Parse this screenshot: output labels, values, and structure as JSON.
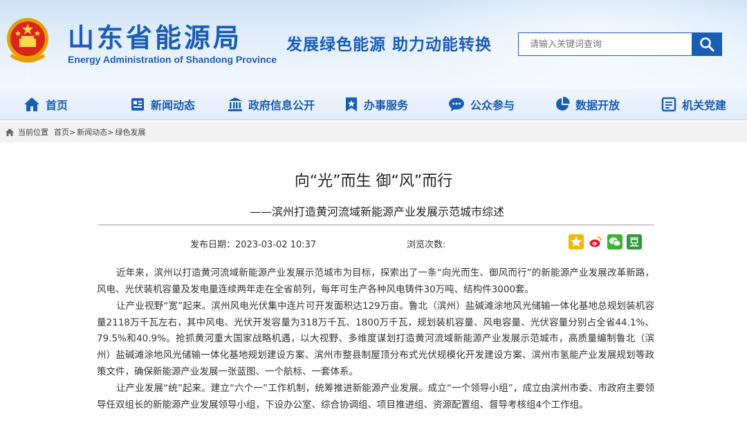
{
  "header": {
    "title": "山东省能源局",
    "subtitle": "Energy Administration of Shandong Province",
    "slogan": "发展绿色能源  助力动能转换",
    "search_placeholder": "请输入关键词查询"
  },
  "nav": {
    "items": [
      {
        "label": "首页",
        "icon": "home-icon"
      },
      {
        "label": "新闻动态",
        "icon": "news-icon"
      },
      {
        "label": "政府信息公开",
        "icon": "government-building-icon"
      },
      {
        "label": "办事服务",
        "icon": "bookmark-star-icon"
      },
      {
        "label": "公众参与",
        "icon": "chat-bubble-icon"
      },
      {
        "label": "数据开放",
        "icon": "pie-chart-icon"
      },
      {
        "label": "机关党建",
        "icon": "party-building-icon"
      }
    ]
  },
  "breadcrumb": {
    "label": "当前位置",
    "items": [
      "首页",
      "新闻动态",
      "绿色发展"
    ],
    "separator": ">"
  },
  "article": {
    "title": "向“光”而生 御“风”而行",
    "subtitle": "——滨州打造黄河流域新能源产业发展示范城市综述",
    "date_label": "发布日期：",
    "date": "2023-03-02 10:37",
    "views_label": "浏览次数:",
    "share": [
      {
        "icon": "qzone-star-icon",
        "color": "#f5b800"
      },
      {
        "icon": "weibo-icon",
        "color": "#e6162d"
      },
      {
        "icon": "wechat-icon",
        "color": "#3eb135"
      },
      {
        "icon": "douban-icon",
        "color": "#2f963d"
      }
    ],
    "paragraphs": [
      "近年来，滨州以打造黄河流域新能源产业发展示范城市为目标，探索出了一条“向光而生、御风而行”的新能源产业发展改革新路，风电、光伏装机容量及发电量连续两年走在全省前列，每年可生产各种风电铸件30万吨、结构件3000套。",
      "让产业视野“宽”起来。滨州风电光伏集中连片可开发面积达129万亩。鲁北（滨州）盐碱滩涂地风光储输一体化基地总规划装机容量2118万千瓦左右，其中风电、光伏开发容量为318万千瓦、1800万千瓦，规划装机容量、风电容量、光伏容量分别占全省44.1%、79.5%和40.9%。抢抓黄河重大国家战略机遇，以大视野、多维度谋划打造黄河流域新能源产业发展示范城市，高质量编制鲁北（滨州）盐碱滩涂地风光储输一体化基地规划建设方案、滨州市整县制屋顶分布式光伏规模化开发建设方案、滨州市氢能产业发展规划等政策文件，确保新能源产业发展一张蓝图、一个航标、一套体系。",
      "让产业发展“统”起来。建立“六个一”工作机制，统筹推进新能源产业发展。成立“一个领导小组”，成立由滨州市委、市政府主要领导任双组长的新能源产业发展领导小组，下设办公室、综合协调组、项目推进组、资源配置组、督导考核组4个工作组。"
    ]
  },
  "colors": {
    "brand_blue": "#1a5db4",
    "divider": "#999999"
  }
}
